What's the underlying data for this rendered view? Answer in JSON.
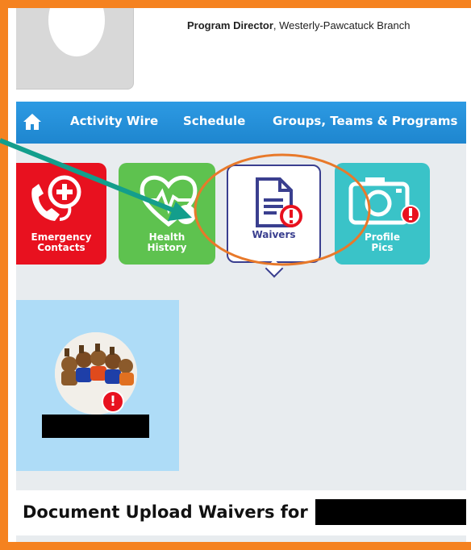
{
  "header": {
    "role_bold": "Program Director",
    "role_rest": ", Westerly-Pawcatuck Branch"
  },
  "navbar": {
    "items": [
      {
        "label": "Activity Wire"
      },
      {
        "label": "Schedule"
      },
      {
        "label": "Groups, Teams & Programs"
      }
    ]
  },
  "tiles": [
    {
      "label": "Emergency Contacts",
      "line1": "Emergency",
      "line2": "Contacts",
      "color": "#e8111f",
      "icon": "phone-plus-icon"
    },
    {
      "label": "Health History",
      "line1": "Health",
      "line2": "History",
      "color": "#5ec24f",
      "icon": "heart-rate-icon"
    },
    {
      "label": "Waivers",
      "line1": "Waivers",
      "line2": "",
      "color": "#3a3f8f",
      "icon": "document-alert-icon",
      "selected": true
    },
    {
      "label": "Profile Pics",
      "line1": "Profile",
      "line2": "Pics",
      "color": "#3ac3c8",
      "icon": "camera-alert-icon"
    }
  ],
  "document": {
    "title": "Document Upload Waivers for"
  },
  "colors": {
    "frame": "#f58220",
    "nav": "#1e86cf",
    "alert": "#e8111f",
    "annotation_arrow": "#139e8c",
    "annotation_circle": "#e8792a"
  }
}
